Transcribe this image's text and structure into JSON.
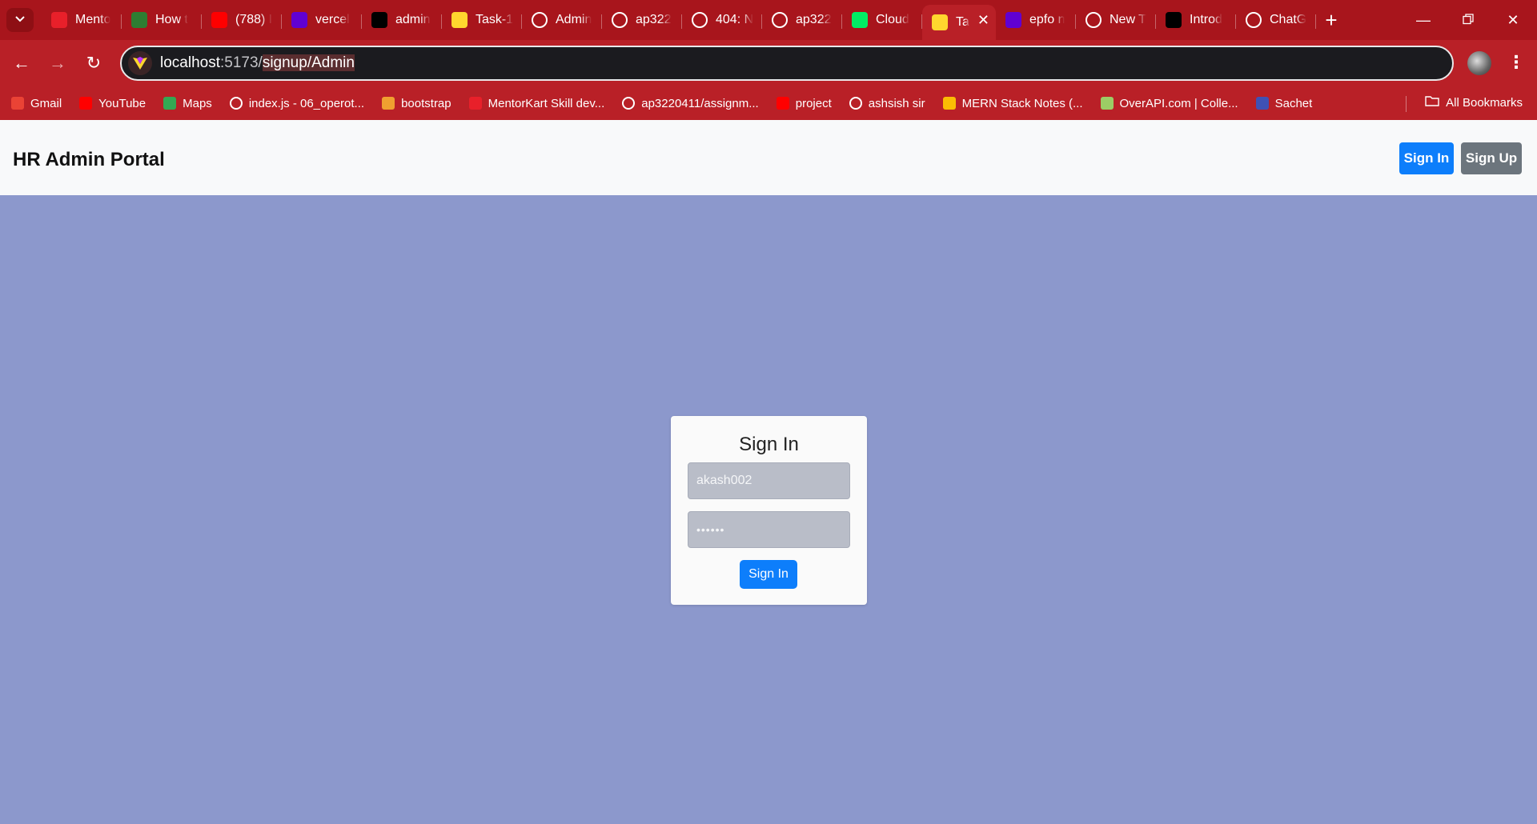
{
  "browser": {
    "tabs": [
      {
        "title": "Mento",
        "icon": "mentorkart-icon",
        "color": "#e8202a"
      },
      {
        "title": "How t",
        "icon": "link-icon",
        "color": "#2e7d32"
      },
      {
        "title": "(788) I",
        "icon": "youtube-icon",
        "color": "#ff0000"
      },
      {
        "title": "vercel",
        "icon": "yahoo-icon",
        "color": "#6001d2"
      },
      {
        "title": "admin",
        "icon": "vercel-icon",
        "color": "#000000"
      },
      {
        "title": "Task-1",
        "icon": "vite-icon",
        "color": "#ffd62e"
      },
      {
        "title": "Admin",
        "icon": "admin-icon",
        "color": "#ffffff"
      },
      {
        "title": "ap322",
        "icon": "github-icon",
        "color": "#ffffff"
      },
      {
        "title": "404: N",
        "icon": "globe-icon",
        "color": "#ffffff"
      },
      {
        "title": "ap322",
        "icon": "github-icon",
        "color": "#ffffff"
      },
      {
        "title": "Cloud",
        "icon": "mongodb-icon",
        "color": "#00ed64"
      },
      {
        "title": "Ta",
        "icon": "vite-icon",
        "color": "#ffd62e",
        "active": true
      },
      {
        "title": "epfo n",
        "icon": "yahoo-icon",
        "color": "#6001d2"
      },
      {
        "title": "New T",
        "icon": "chrome-icon",
        "color": "#ffffff"
      },
      {
        "title": "Introd",
        "icon": "openai-icon",
        "color": "#000000"
      },
      {
        "title": "ChatG",
        "icon": "openai-icon",
        "color": "#ffffff"
      }
    ],
    "url": {
      "host": "localhost",
      "port": ":5173/",
      "path": "signup/Admin"
    },
    "bookmarks": [
      {
        "label": "Gmail",
        "icon": "gmail-icon",
        "color": "#ea4335"
      },
      {
        "label": "YouTube",
        "icon": "youtube-icon",
        "color": "#ff0000"
      },
      {
        "label": "Maps",
        "icon": "maps-icon",
        "color": "#34a853"
      },
      {
        "label": "index.js - 06_operot...",
        "icon": "globe-icon",
        "color": "#ffffff"
      },
      {
        "label": "bootstrap",
        "icon": "bootstrap-icon",
        "color": "#f0a030"
      },
      {
        "label": "MentorKart Skill dev...",
        "icon": "mentorkart-icon",
        "color": "#e8202a"
      },
      {
        "label": "ap3220411/assignm...",
        "icon": "github-icon",
        "color": "#ffffff"
      },
      {
        "label": "project",
        "icon": "youtube-icon",
        "color": "#ff0000"
      },
      {
        "label": "ashsish sir",
        "icon": "github-icon",
        "color": "#ffffff"
      },
      {
        "label": "MERN Stack Notes (...",
        "icon": "drive-icon",
        "color": "#fbbc04"
      },
      {
        "label": "OverAPI.com | Colle...",
        "icon": "overapi-icon",
        "color": "#9ccc65"
      },
      {
        "label": "Sachet",
        "icon": "sachet-icon",
        "color": "#3f51b5"
      }
    ],
    "all_bookmarks": "All Bookmarks"
  },
  "page": {
    "brand": "HR Admin Portal",
    "nav_signin": "Sign In",
    "nav_signup": "Sign Up",
    "form": {
      "title": "Sign In",
      "username_value": "akash002",
      "password_value": "••••••",
      "submit": "Sign In"
    },
    "colors": {
      "background": "#8c98cc",
      "primary": "#0d7efb",
      "secondary": "#6c757d",
      "chrome": "#b92027"
    }
  }
}
